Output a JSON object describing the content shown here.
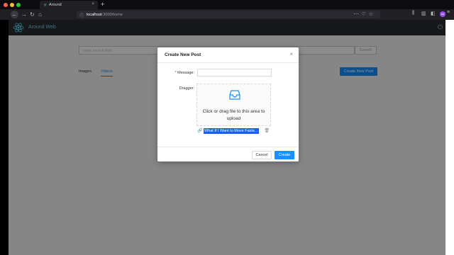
{
  "browser": {
    "tab_title": "Around",
    "tab_close": "×",
    "new_tab": "+",
    "url_host": "localhost",
    "url_path": ":3000/home",
    "avatar_text": "oo",
    "accent": "#61dafb"
  },
  "app": {
    "title": "Around Web",
    "search_placeholder": "input search text",
    "search_button": "Search",
    "tabs": [
      {
        "label": "Images",
        "active": false
      },
      {
        "label": "Videos",
        "active": true
      }
    ],
    "create_button": "Create New Post",
    "primary_color": "#1890ff"
  },
  "modal": {
    "title": "Create New Post",
    "close": "×",
    "message_label": "Message",
    "required_mark": "*",
    "message_value": "",
    "dragger_label": "Dragger",
    "dragger_text": "Click or drag file to this area to upload",
    "file_name": "What If I Want to Move Faste...",
    "cancel_label": "Cancel",
    "create_label": "Create"
  },
  "icons": [
    "react-logo-icon",
    "logout-icon",
    "inbox-icon",
    "paperclip-icon",
    "trash-icon",
    "lock-icon",
    "back-icon",
    "forward-icon",
    "reload-icon",
    "home-icon"
  ]
}
